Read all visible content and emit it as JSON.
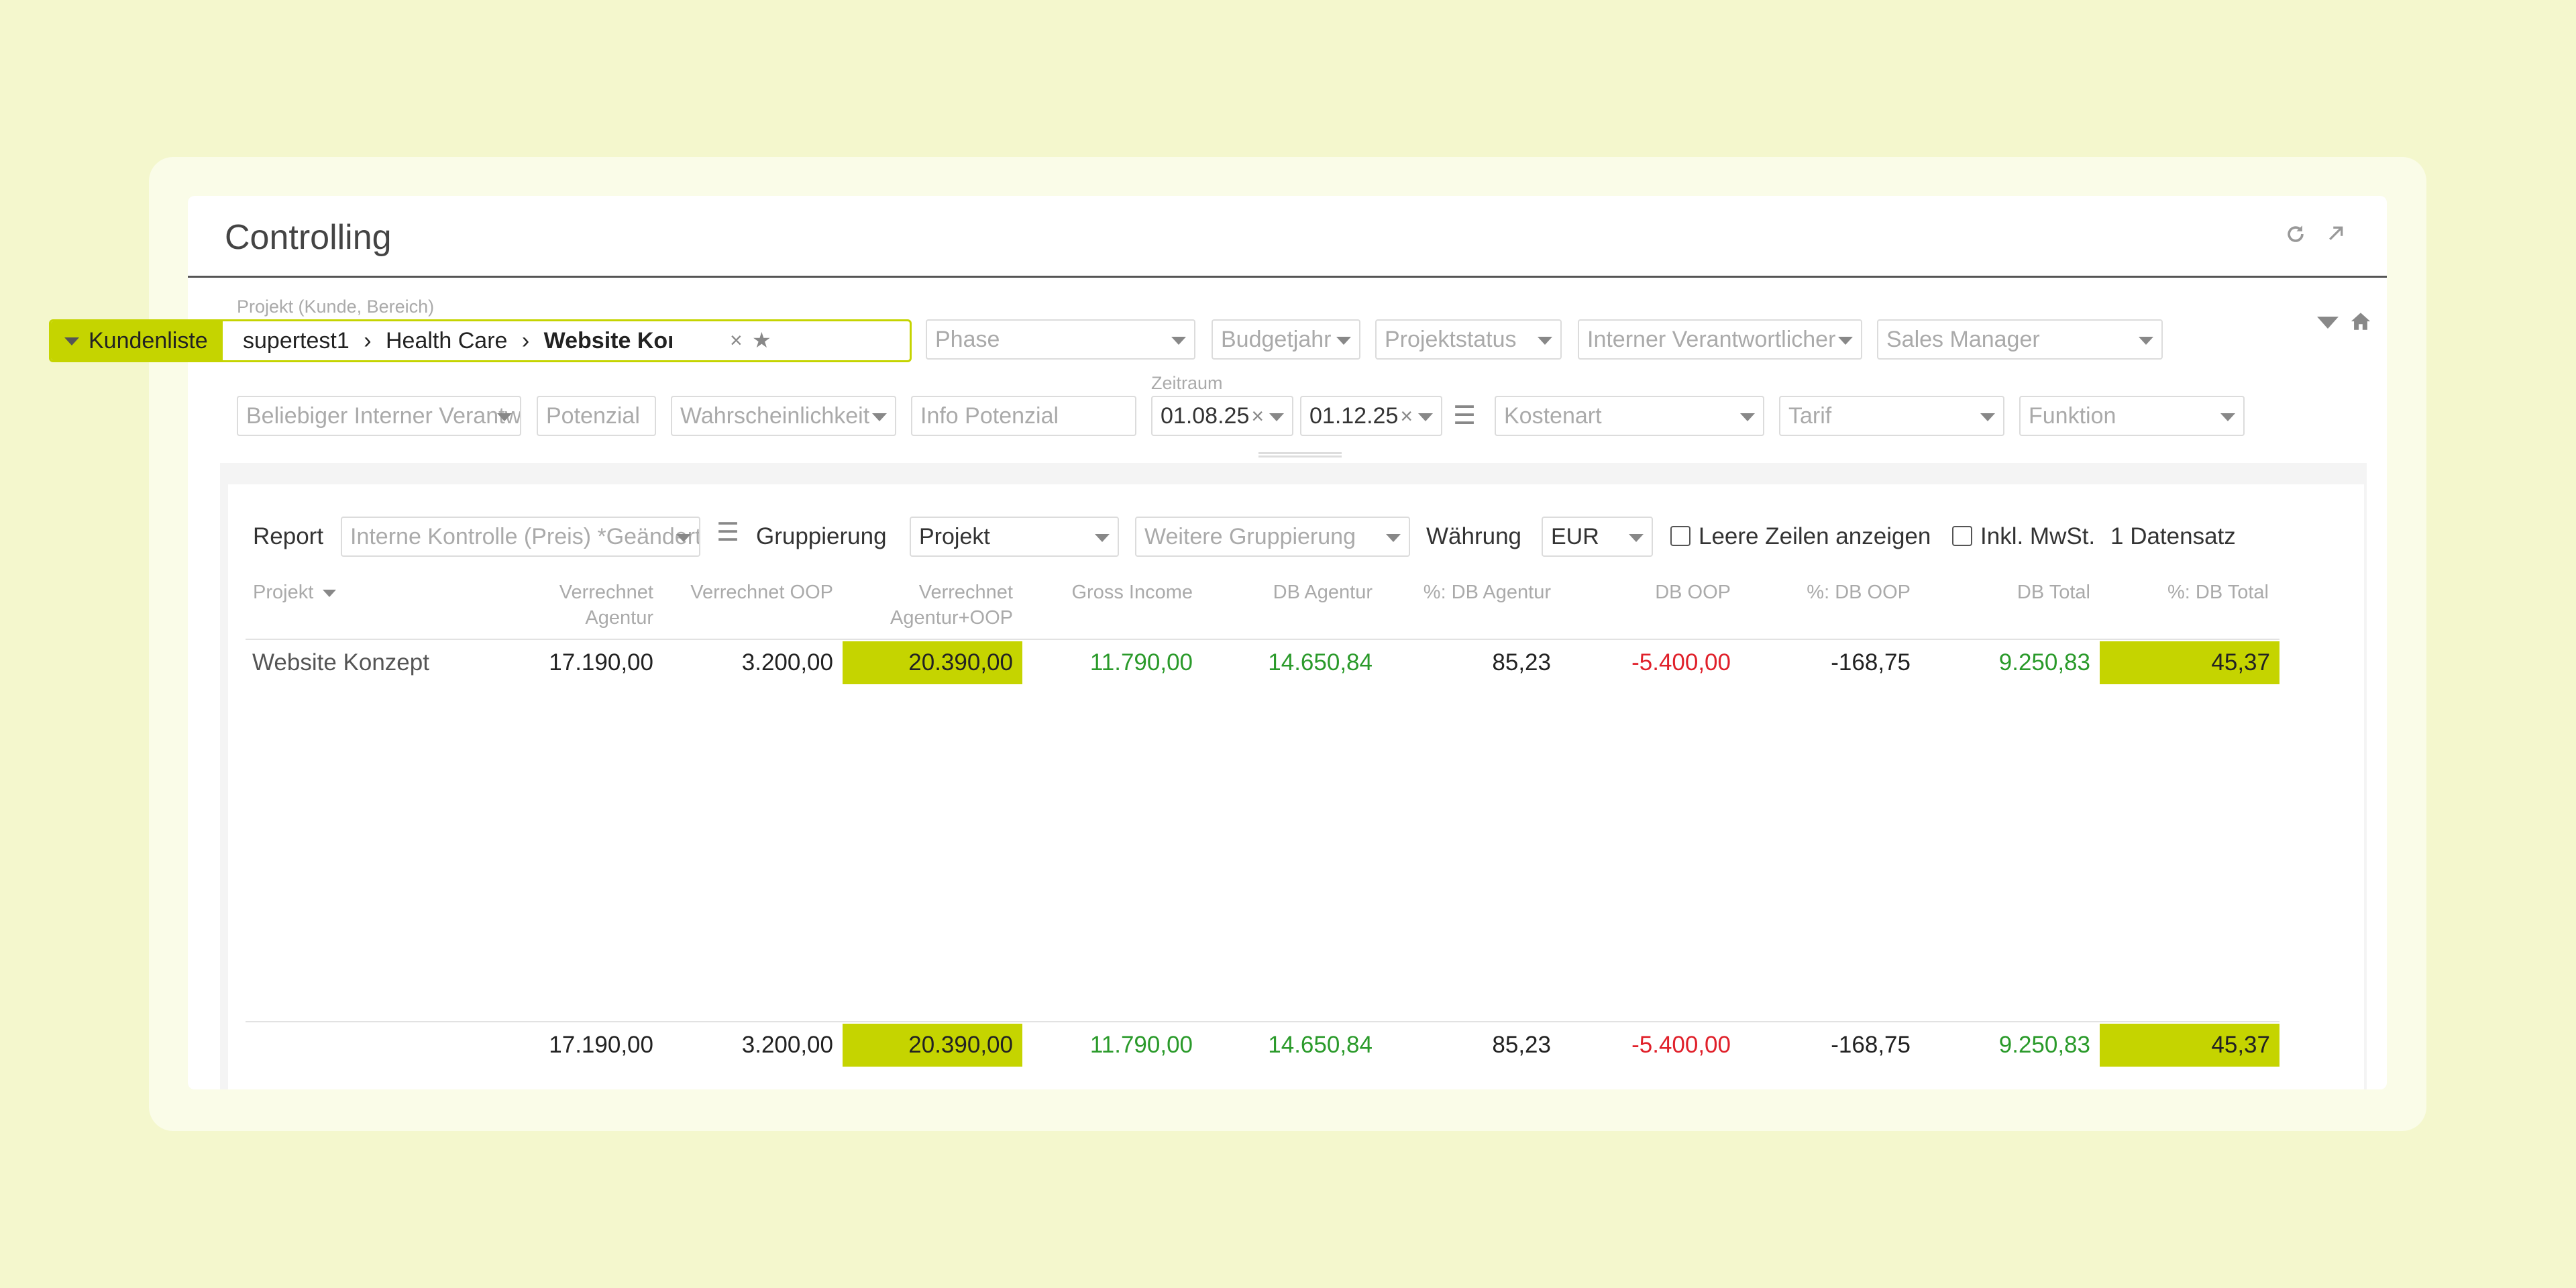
{
  "title": "Controlling",
  "icons": {
    "refresh": "refresh-icon",
    "expand": "external-link-icon",
    "filter_toggle": "chevron-down-icon",
    "home": "home-icon"
  },
  "filters": {
    "project_label": "Projekt (Kunde, Bereich)",
    "project_tag": "Kundenliste",
    "project_path_1": "supertest1",
    "project_sep": "›",
    "project_path_2": "Health Care",
    "project_path_3": "Website Konzept",
    "project_clear": "×",
    "project_star": "★",
    "phase": "Phase",
    "budgetjahr": "Budgetjahr",
    "projektstatus": "Projektstatus",
    "interner_verantwortlicher": "Interner Verantwortlicher",
    "sales_manager": "Sales Manager",
    "beliebiger": "Beliebiger Interner Verantwortlicher",
    "potenzial": "Potenzial",
    "wahrscheinlichkeit": "Wahrscheinlichkeit",
    "info_potenzial": "Info Potenzial",
    "zeitraum_label": "Zeitraum",
    "date_from": "01.08.25",
    "date_to": "01.12.25",
    "date_clear": "×",
    "kostenart": "Kostenart",
    "tarif": "Tarif",
    "funktion": "Funktion"
  },
  "report_bar": {
    "report_label": "Report",
    "report_value": "Interne Kontrolle (Preis) *Geändert",
    "gruppierung_label": "Gruppierung",
    "gruppierung_value": "Projekt",
    "weitere_gruppierung": "Weitere Gruppierung",
    "waehrung_label": "Währung",
    "waehrung_value": "EUR",
    "leere_zeilen": "Leere Zeilen anzeigen",
    "inkl_mwst": "Inkl. MwSt.",
    "count": "1 Datensatz"
  },
  "table": {
    "headers": {
      "projekt": "Projekt",
      "verrechnet_agentur_1": "Verrechnet",
      "verrechnet_agentur_2": "Agentur",
      "verrechnet_oop": "Verrechnet OOP",
      "verrechnet_agentur_oop_1": "Verrechnet",
      "verrechnet_agentur_oop_2": "Agentur+OOP",
      "gross_income": "Gross Income",
      "db_agentur": "DB Agentur",
      "pct_db_agentur": "%: DB Agentur",
      "db_oop": "DB OOP",
      "pct_db_oop": "%: DB OOP",
      "db_total": "DB Total",
      "pct_db_total": "%: DB Total"
    },
    "row": {
      "projekt": "Website Konzept",
      "verrechnet_agentur": "17.190,00",
      "verrechnet_oop": "3.200,00",
      "verrechnet_agentur_oop": "20.390,00",
      "gross_income": "11.790,00",
      "db_agentur": "14.650,84",
      "pct_db_agentur": "85,23",
      "db_oop": "-5.400,00",
      "pct_db_oop": "-168,75",
      "db_total": "9.250,83",
      "pct_db_total": "45,37"
    },
    "total": {
      "verrechnet_agentur": "17.190,00",
      "verrechnet_oop": "3.200,00",
      "verrechnet_agentur_oop": "20.390,00",
      "gross_income": "11.790,00",
      "db_agentur": "14.650,84",
      "pct_db_agentur": "85,23",
      "db_oop": "-5.400,00",
      "pct_db_oop": "-168,75",
      "db_total": "9.250,83",
      "pct_db_total": "45,37"
    }
  },
  "colors": {
    "accent": "#c5d400",
    "positive": "#2a9a2a",
    "negative": "#e0202a",
    "background": "#f4f7cd"
  }
}
